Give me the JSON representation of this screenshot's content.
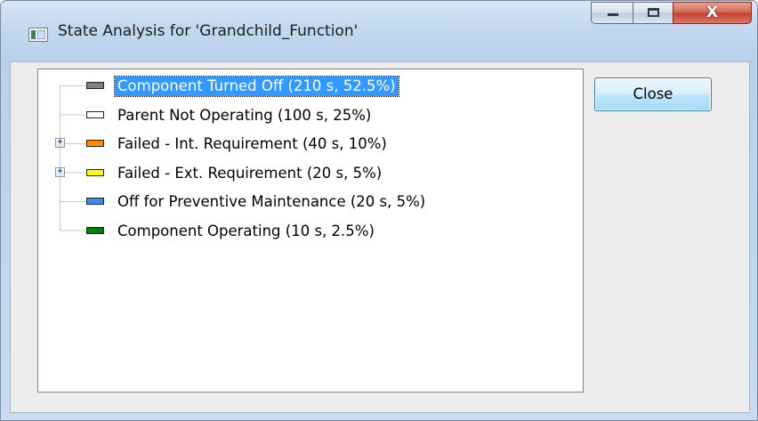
{
  "window": {
    "title": "State Analysis for 'Grandchild_Function'",
    "caption_buttons": {
      "minimize_icon": "minimize-icon",
      "maximize_icon": "maximize-icon",
      "close_glyph": "X"
    }
  },
  "tree": {
    "items": [
      {
        "label": "Component Turned Off (210 s, 52.5%)",
        "color": "#808080",
        "selected": true,
        "expandable": false
      },
      {
        "label": "Parent Not Operating (100 s, 25%)",
        "color": "#ffffff",
        "selected": false,
        "expandable": false
      },
      {
        "label": "Failed - Int. Requirement (40 s, 10%)",
        "color": "#ff8c00",
        "selected": false,
        "expandable": true
      },
      {
        "label": "Failed - Ext. Requirement (20 s, 5%)",
        "color": "#ffff00",
        "selected": false,
        "expandable": true
      },
      {
        "label": "Off for Preventive Maintenance (20 s, 5%)",
        "color": "#3b8ee8",
        "selected": false,
        "expandable": false
      },
      {
        "label": "Component Operating (10 s, 2.5%)",
        "color": "#008000",
        "selected": false,
        "expandable": false
      }
    ],
    "expander_glyph": "+"
  },
  "buttons": {
    "close_label": "Close"
  },
  "colors": {
    "selection": "#3399ff",
    "titlebar": "#c4d9ee",
    "close_button_red": "#c2412a"
  }
}
